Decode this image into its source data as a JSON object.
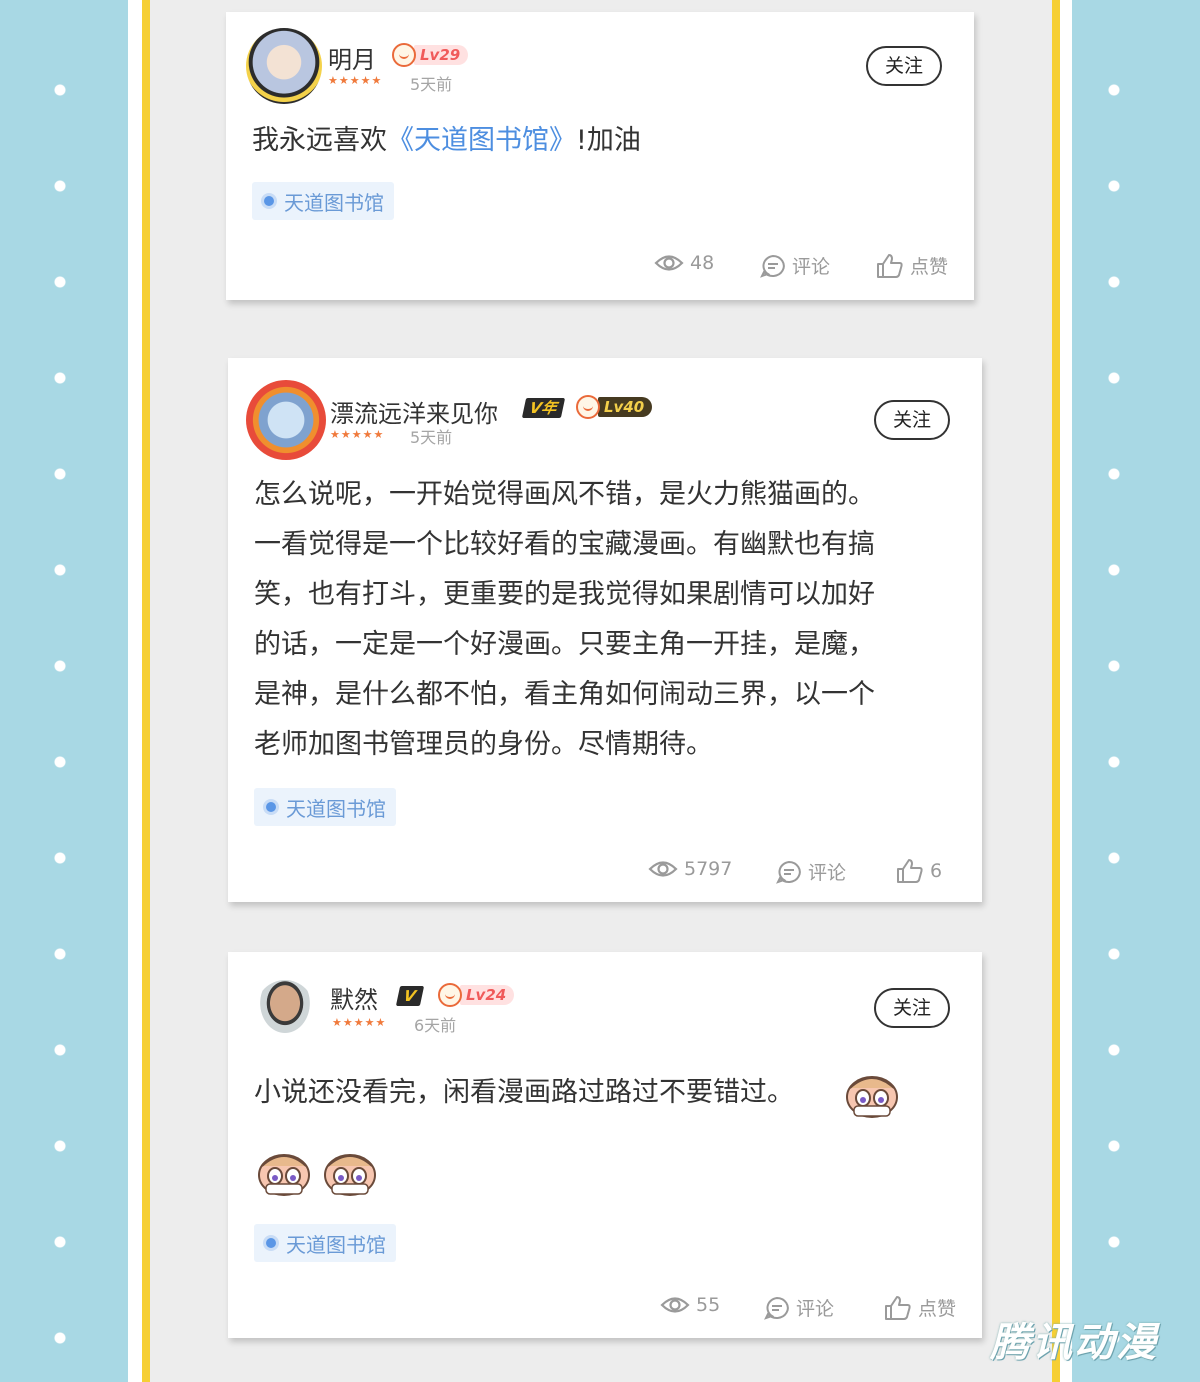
{
  "colors": {
    "accent_link": "#4d8ee0",
    "tag_bg": "#ebf3fc",
    "border_yellow": "#f6cf34",
    "side_blue": "#a8d8e4"
  },
  "comments": [
    {
      "username": "明月",
      "level": "Lv29",
      "stars": "★★★★★",
      "time": "5天前",
      "follow_label": "关注",
      "text_before": "我永远喜欢",
      "text_link": "《天道图书馆》",
      "text_after": "!加油",
      "tag": "天道图书馆",
      "views": "48",
      "comment_label": "评论",
      "like_label": "点赞"
    },
    {
      "username": "漂流远洋来见你",
      "vip_badge": "V年",
      "level": "Lv40",
      "stars": "★★★★★",
      "time": "5天前",
      "follow_label": "关注",
      "text_lines": [
        "怎么说呢，一开始觉得画风不错，是火力熊猫画的。",
        "一看觉得是一个比较好看的宝藏漫画。有幽默也有搞",
        "笑，也有打斗，更重要的是我觉得如果剧情可以加好",
        "的话，一定是一个好漫画。只要主角一开挂，是魔，",
        "是神，是什么都不怕，看主角如何闹动三界，以一个",
        "老师加图书管理员的身份。尽情期待。"
      ],
      "tag": "天道图书馆",
      "views": "5797",
      "comment_label": "评论",
      "likes": "6"
    },
    {
      "username": "默然",
      "vip_badge": "V",
      "level": "Lv24",
      "stars": "★★★★★",
      "time": "6天前",
      "follow_label": "关注",
      "text": "小说还没看完，闲看漫画路过路过不要错过。",
      "tag": "天道图书馆",
      "views": "55",
      "comment_label": "评论",
      "like_label": "点赞"
    }
  ],
  "watermark": "腾讯动漫"
}
